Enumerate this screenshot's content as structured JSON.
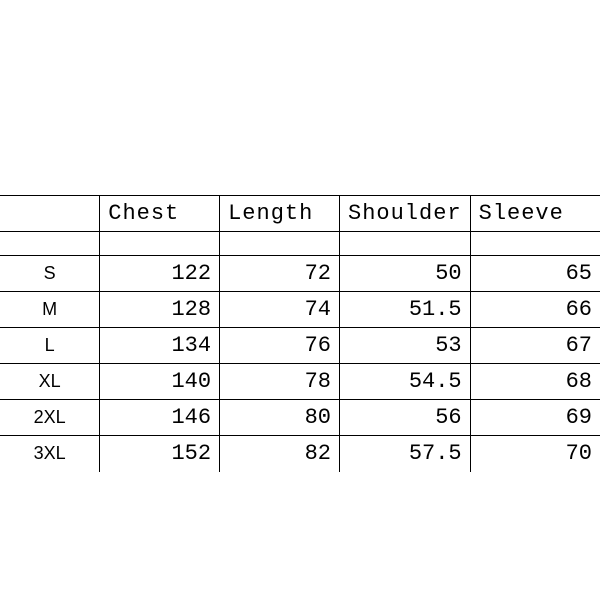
{
  "chart_data": {
    "type": "table",
    "headers": [
      "",
      "Chest",
      "Length",
      "Shoulder",
      "Sleeve"
    ],
    "rows": [
      {
        "size": "S",
        "chest": 122,
        "length": 72,
        "shoulder": 50,
        "sleeve": 65
      },
      {
        "size": "M",
        "chest": 128,
        "length": 74,
        "shoulder": 51.5,
        "sleeve": 66
      },
      {
        "size": "L",
        "chest": 134,
        "length": 76,
        "shoulder": 53,
        "sleeve": 67
      },
      {
        "size": "XL",
        "chest": 140,
        "length": 78,
        "shoulder": 54.5,
        "sleeve": 68
      },
      {
        "size": "2XL",
        "chest": 146,
        "length": 80,
        "shoulder": 56,
        "sleeve": 69
      },
      {
        "size": "3XL",
        "chest": 152,
        "length": 82,
        "shoulder": 57.5,
        "sleeve": 70
      }
    ]
  }
}
